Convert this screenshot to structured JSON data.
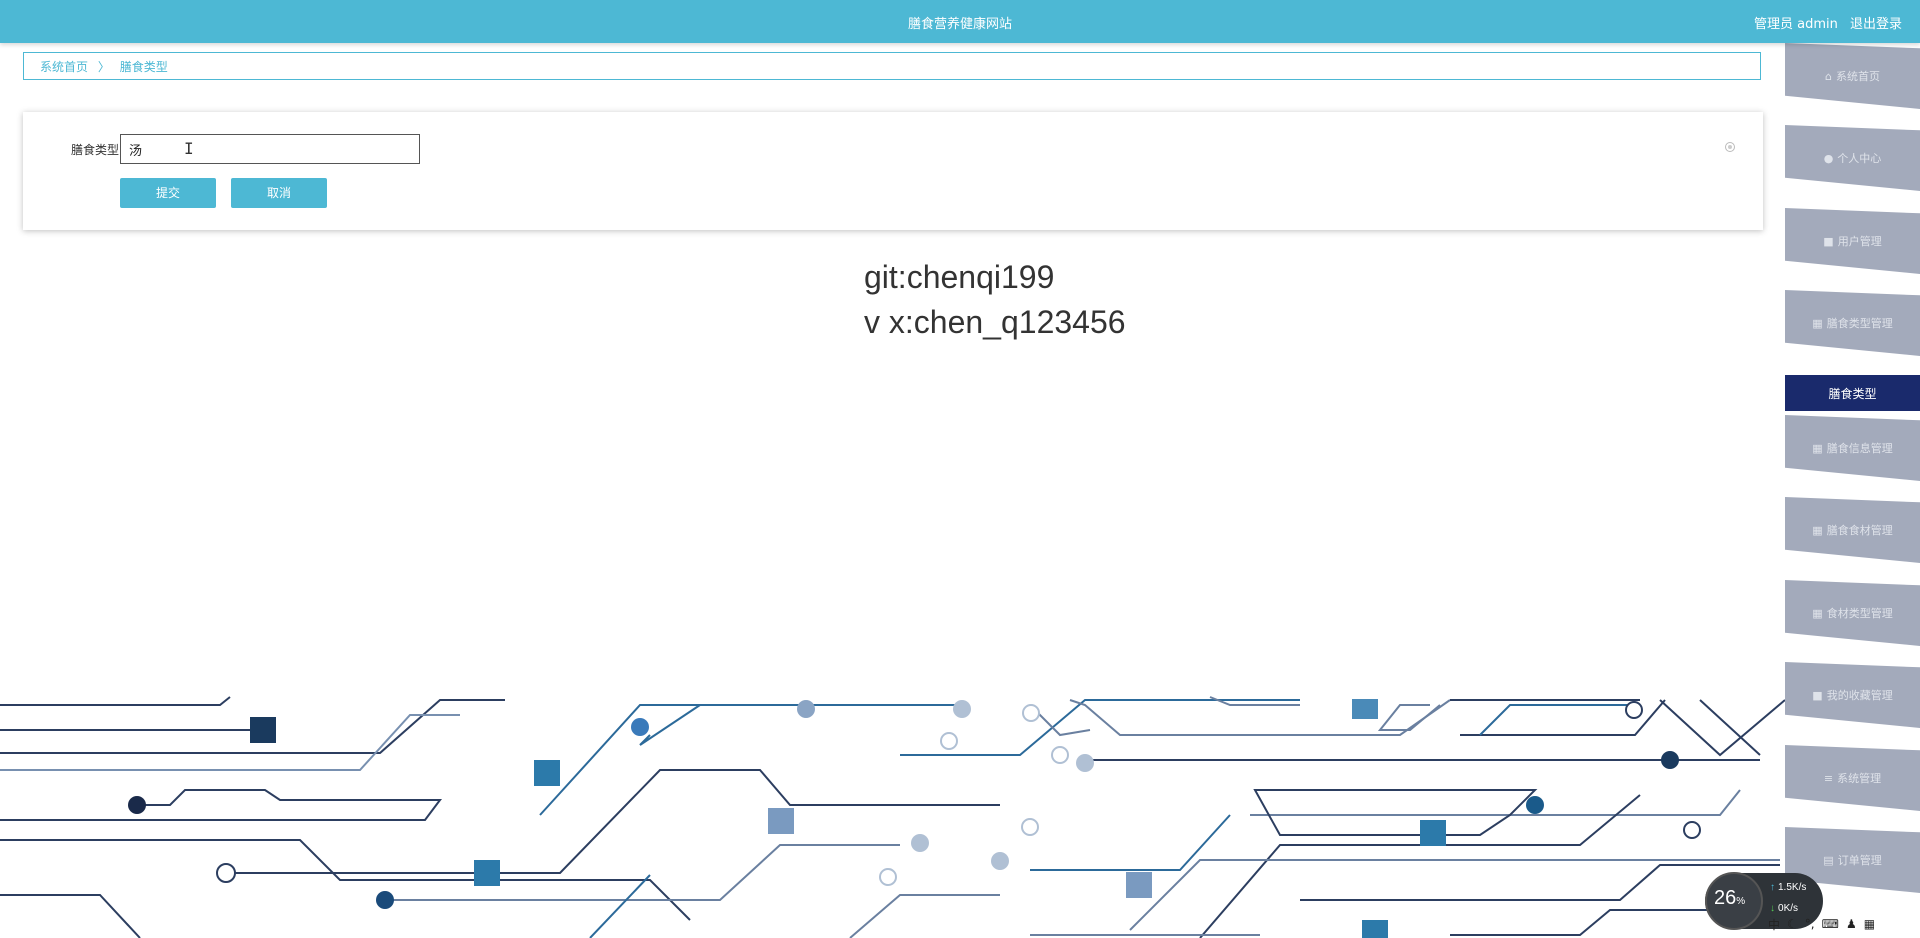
{
  "header": {
    "site_title": "膳食营养健康网站",
    "user_label": "管理员 admin",
    "logout_label": "退出登录"
  },
  "breadcrumb": {
    "home": "系统首页",
    "separator": "〉",
    "current": "膳食类型"
  },
  "form": {
    "field_label": "膳食类型",
    "field_value": "汤",
    "submit_label": "提交",
    "cancel_label": "取消"
  },
  "watermark": {
    "line1": "git:chenqi199",
    "line2": "v x:chen_q123456"
  },
  "sidebar": {
    "items": [
      {
        "label": "系统首页",
        "icon": "⌂"
      },
      {
        "label": "个人中心",
        "icon": "●"
      },
      {
        "label": "用户管理",
        "icon": "■"
      },
      {
        "label": "膳食类型管理",
        "icon": "▦"
      },
      {
        "label": "膳食类型",
        "icon": ""
      },
      {
        "label": "膳食信息管理",
        "icon": "▦"
      },
      {
        "label": "膳食食材管理",
        "icon": "▦"
      },
      {
        "label": "食材类型管理",
        "icon": "▦"
      },
      {
        "label": "我的收藏管理",
        "icon": "■"
      },
      {
        "label": "系统管理",
        "icon": "≡"
      },
      {
        "label": "订单管理",
        "icon": "▤"
      }
    ]
  },
  "net_widget": {
    "percent": "26",
    "percent_unit": "%",
    "upload": "1.5",
    "download": "0",
    "unit": "K/s"
  },
  "colors": {
    "accent": "#4db8d4",
    "sidebar_item": "#a3aabb",
    "sidebar_active": "#1a2a6c"
  }
}
